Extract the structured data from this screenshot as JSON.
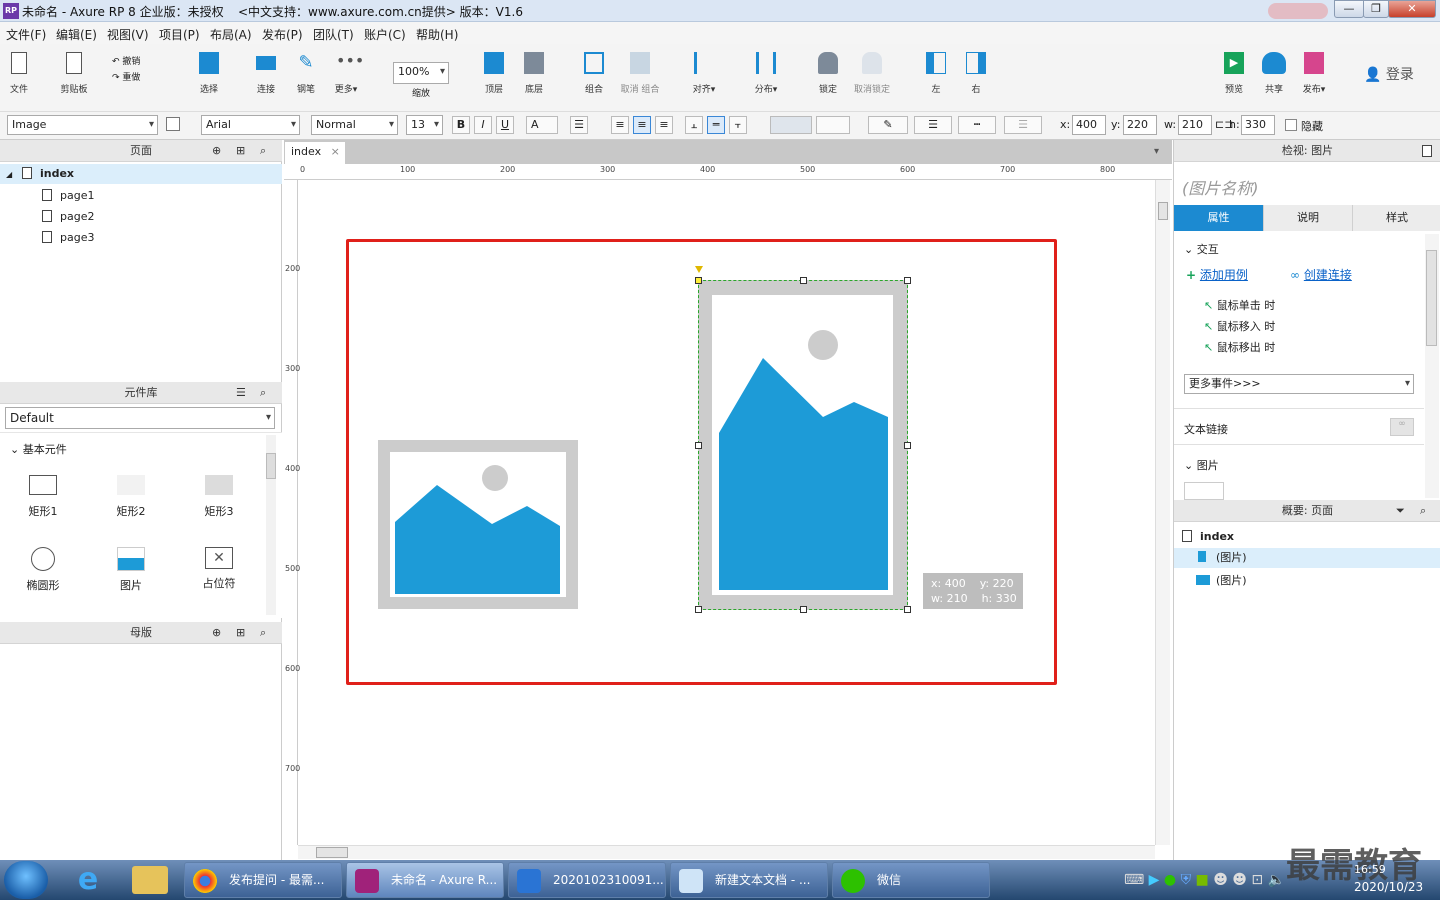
{
  "window": {
    "title": "未命名 - Axure RP 8 企业版：未授权",
    "title_extra": "<中文支持：www.axure.com.cn提供> 版本：V1.6",
    "app_icon_text": "RP",
    "controls": [
      "—",
      "❐",
      "✕"
    ]
  },
  "menu": [
    "文件(F)",
    "编辑(E)",
    "视图(V)",
    "项目(P)",
    "布局(A)",
    "发布(P)",
    "团队(T)",
    "账户(C)",
    "帮助(H)"
  ],
  "toolbar": {
    "file": "文件",
    "clipboard": "剪贴板",
    "undo": "撤销",
    "redo": "重做",
    "select": "选择",
    "connect": "连接",
    "pen": "钢笔",
    "more": "更多▾",
    "zoom_value": "100%",
    "zoom_label": "缩放",
    "top": "顶层",
    "bottom": "底层",
    "group": "组合",
    "ungroup": "取消 组合",
    "align": "对齐▾",
    "distribute": "分布▾",
    "lock": "锁定",
    "unlock": "取消锁定",
    "left": "左",
    "right": "右",
    "preview": "预览",
    "share": "共享",
    "publish": "发布▾",
    "login": "登录"
  },
  "format": {
    "style": "Image",
    "font": "Arial",
    "weight": "Normal",
    "size": "13",
    "bold": "B",
    "italic": "I",
    "underline": "U",
    "fontcolor": "A",
    "x_label": "x:",
    "x": "400",
    "y_label": "y:",
    "y": "220",
    "w_label": "w:",
    "w": "210",
    "h_label": "h:",
    "h": "330",
    "hide": "隐藏"
  },
  "pages": {
    "title": "页面",
    "items": [
      "index",
      "page1",
      "page2",
      "page3"
    ]
  },
  "library": {
    "title": "元件库",
    "selected": "Default",
    "group": "基本元件",
    "widgets": [
      "矩形1",
      "矩形2",
      "矩形3",
      "椭圆形",
      "图片",
      "占位符"
    ]
  },
  "masters": {
    "title": "母版"
  },
  "canvas": {
    "tab": "index",
    "ruler_h": [
      "0",
      "100",
      "200",
      "300",
      "400",
      "500",
      "600",
      "700",
      "800"
    ],
    "ruler_v": [
      "200",
      "300",
      "400",
      "500",
      "600",
      "700"
    ],
    "tooltip": {
      "line1": "x: 400    y: 220",
      "line2": "w: 210    h: 330"
    }
  },
  "inspector": {
    "title": "检视: 图片",
    "name_placeholder": "(图片名称)",
    "tabs": [
      "属性",
      "说明",
      "样式"
    ],
    "interaction": "交互",
    "add_case": "添加用例",
    "create_link": "创建连接",
    "events": [
      "鼠标单击 时",
      "鼠标移入 时",
      "鼠标移出 时"
    ],
    "more_events": "更多事件>>>",
    "text_link": "文本链接",
    "image_section": "图片"
  },
  "outline": {
    "title": "概要: 页面",
    "root": "index",
    "items": [
      "(图片)",
      "(图片)"
    ]
  },
  "taskbar": {
    "items": [
      "发布提问 - 最需...",
      "未命名 - Axure R...",
      "2020102310091...",
      "新建文本文档 - ...",
      "微信"
    ],
    "time": "16:59",
    "date": "2020/10/23",
    "watermark": "最需教育"
  },
  "colors": {
    "accent": "#1c8ad1",
    "highlight_box": "#e0201a",
    "image_blue": "#1d9bd7"
  }
}
